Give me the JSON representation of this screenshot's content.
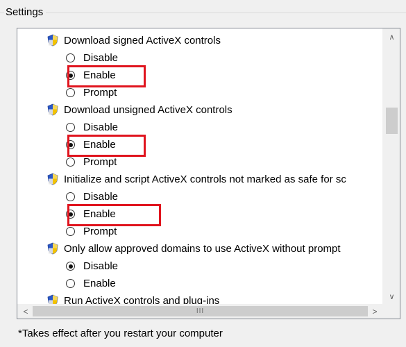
{
  "group": {
    "title": "Settings"
  },
  "settings": [
    {
      "title": "Download signed ActiveX controls",
      "options": [
        "Disable",
        "Enable",
        "Prompt"
      ],
      "selected": "Enable"
    },
    {
      "title": "Download unsigned ActiveX controls",
      "options": [
        "Disable",
        "Enable",
        "Prompt"
      ],
      "selected": "Enable"
    },
    {
      "title": "Initialize and script ActiveX controls not marked as safe for sc",
      "options": [
        "Disable",
        "Enable",
        "Prompt"
      ],
      "selected": "Enable"
    },
    {
      "title": "Only allow approved domains to use ActiveX without prompt",
      "options": [
        "Disable",
        "Enable"
      ],
      "selected": "Disable"
    },
    {
      "title": "Run ActiveX controls and plug-ins"
    }
  ],
  "scrollbars": {
    "up_arrow": "∧",
    "down_arrow": "∨",
    "left_arrow": "<",
    "right_arrow": ">",
    "h_grip": "III"
  },
  "footnote": "*Takes effect after you restart your computer",
  "colors": {
    "highlight": "#e0141e",
    "shield_blue": "#2a58c8",
    "shield_gold": "#f2c200"
  },
  "icons": {
    "setting": "security-shield-icon"
  }
}
